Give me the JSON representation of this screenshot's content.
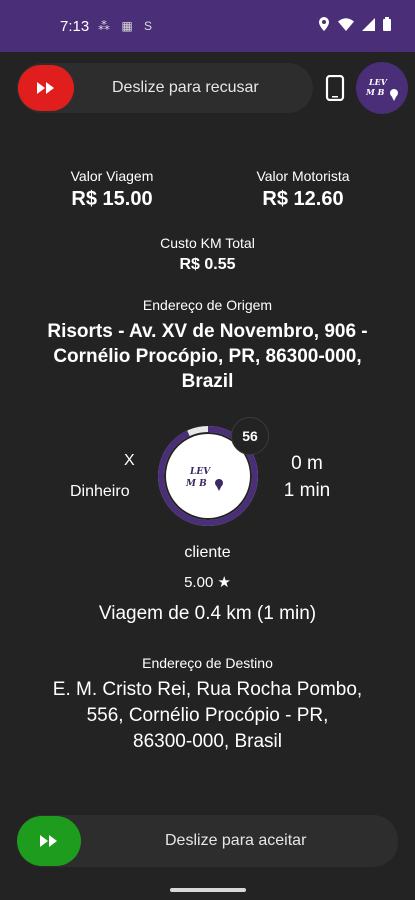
{
  "status": {
    "time": "7:13",
    "left_icons": "⁂ ▦ S"
  },
  "header": {
    "refuse_label": "Deslize para recusar"
  },
  "fare": {
    "trip_label": "Valor Viagem",
    "trip_value": "R$ 15.00",
    "driver_label": "Valor Motorista",
    "driver_value": "R$ 12.60",
    "cost_label": "Custo KM Total",
    "cost_value": "R$ 0.55"
  },
  "origin": {
    "label": "Endereço de Origem",
    "lines": [
      "Risorts - Av. XV de Novembro, 906 -",
      "Cornélio Procópio, PR, 86300-000,",
      "Brazil"
    ]
  },
  "trip": {
    "left_mark": "X",
    "payment": "Dinheiro",
    "countdown": "56",
    "countdown_fraction": 0.93,
    "distance": "0 m",
    "duration": "1 min",
    "client_name": "cliente",
    "rating": "5.00 ★",
    "summary": "Viagem de 0.4 km (1 min)"
  },
  "destination": {
    "label": "Endereço de Destino",
    "lines": [
      "E. M. Cristo Rei, Rua Rocha Pombo,",
      "556, Cornélio Procópio - PR,",
      "86300-000, Brasil"
    ]
  },
  "footer": {
    "accept_label": "Deslize para aceitar"
  },
  "colors": {
    "brand": "#4a2e78",
    "refuse": "#e01e1e",
    "accept": "#1e9c1e"
  }
}
